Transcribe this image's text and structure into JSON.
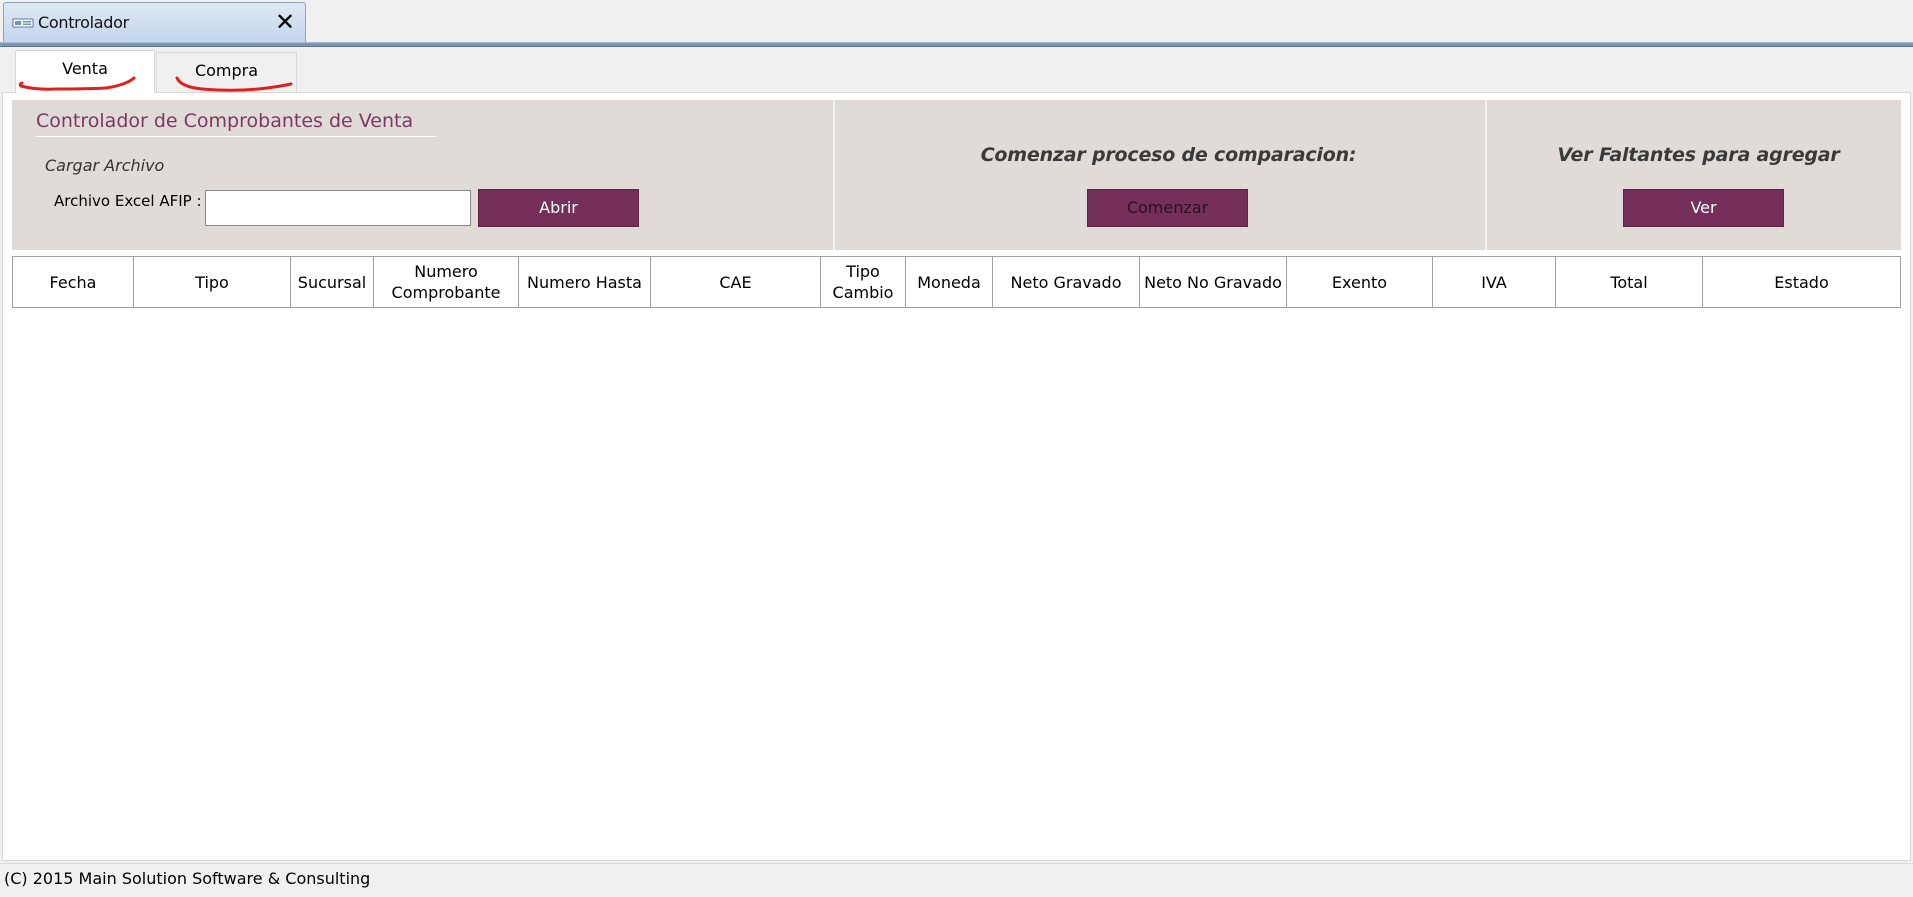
{
  "window": {
    "tab_title": "Controlador",
    "tab_icon": "form-icon",
    "close_label": "✕"
  },
  "tabs": [
    {
      "label": "Venta",
      "selected": true
    },
    {
      "label": "Compra",
      "selected": false
    }
  ],
  "annotation_color": "#e0201b",
  "header": {
    "section_title": "Controlador de Comprobantes de Venta",
    "group_label": "Cargar Archivo",
    "file_label": "Archivo Excel AFIP :",
    "file_value": "",
    "abrir_label": "Abrir",
    "comenzar_heading": "Comenzar proceso de comparacion:",
    "comenzar_label": "Comenzar",
    "ver_heading": "Ver Faltantes para agregar",
    "ver_label": "Ver"
  },
  "grid": {
    "columns": [
      "Fecha",
      "Tipo",
      "Sucursal",
      "Numero Comprobante",
      "Numero Hasta",
      "CAE",
      "Tipo Cambio",
      "Moneda",
      "Neto Gravado",
      "Neto No Gravado",
      "Exento",
      "IVA",
      "Total",
      "Estado"
    ],
    "rows": []
  },
  "footer": {
    "copyright": "(C) 2015 Main Solution Software & Consulting"
  },
  "colors": {
    "accent_purple": "#742f5a",
    "title_purple": "#7e3764",
    "panel_bg": "#e0dbd7"
  }
}
